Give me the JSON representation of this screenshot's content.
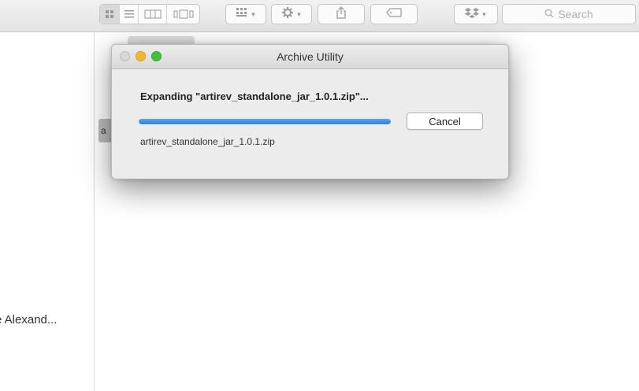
{
  "toolbar": {
    "search_placeholder": "Search",
    "view_icons": [
      "icon-view-icon",
      "list-view-icon",
      "column-view-icon",
      "coverflow-view-icon"
    ],
    "buttons": [
      "arrange-icon",
      "gear-icon",
      "share-icon",
      "tag-icon",
      "dropbox-icon"
    ]
  },
  "sidebar": {
    "partial_label": "e Alexand..."
  },
  "background": {
    "partial_item_label": "a"
  },
  "dialog": {
    "title": "Archive Utility",
    "heading": "Expanding \"artirev_standalone_jar_1.0.1.zip\"...",
    "filename": "artirev_standalone_jar_1.0.1.zip",
    "cancel_label": "Cancel",
    "progress_percent": 100,
    "colors": {
      "progress": "#3b8be0",
      "close": "#d6d6d6",
      "minimize": "#f5b82d",
      "zoom": "#3fc13d"
    }
  }
}
